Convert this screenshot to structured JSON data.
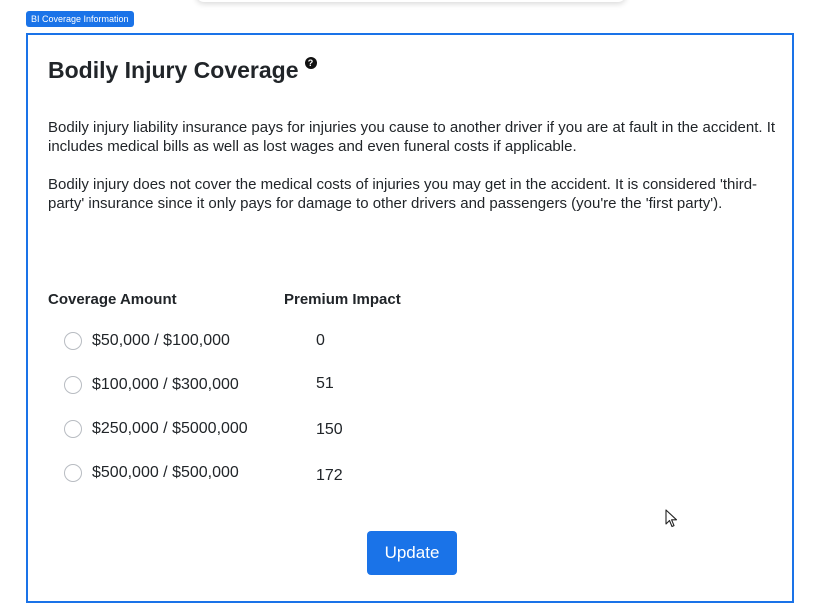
{
  "badge": "BI Coverage Information",
  "card": {
    "title": "Bodily Injury Coverage",
    "help_icon": "question-circle-icon",
    "paragraphs": [
      "Bodily injury liability insurance pays for injuries you cause to another driver if you are at fault in the accident. It includes medical bills as well as lost wages and even funeral costs if applicable.",
      "Bodily injury does not cover the medical costs of injuries you may get in the accident. It is considered 'third-party' insurance since it only pays for damage to other drivers and passengers (you're the 'first party')."
    ],
    "headers": {
      "coverage": "Coverage Amount",
      "premium": "Premium Impact"
    },
    "options": [
      {
        "label": "$50,000 / $100,000",
        "premium": "0",
        "selected": false
      },
      {
        "label": "$100,000 / $300,000",
        "premium": "51",
        "selected": false
      },
      {
        "label": "$250,000 / $5000,000",
        "premium": "150",
        "selected": false
      },
      {
        "label": "$500,000 / $500,000",
        "premium": "172",
        "selected": false
      }
    ],
    "update_label": "Update"
  },
  "colors": {
    "accent": "#1a73e8",
    "text": "#212529"
  }
}
